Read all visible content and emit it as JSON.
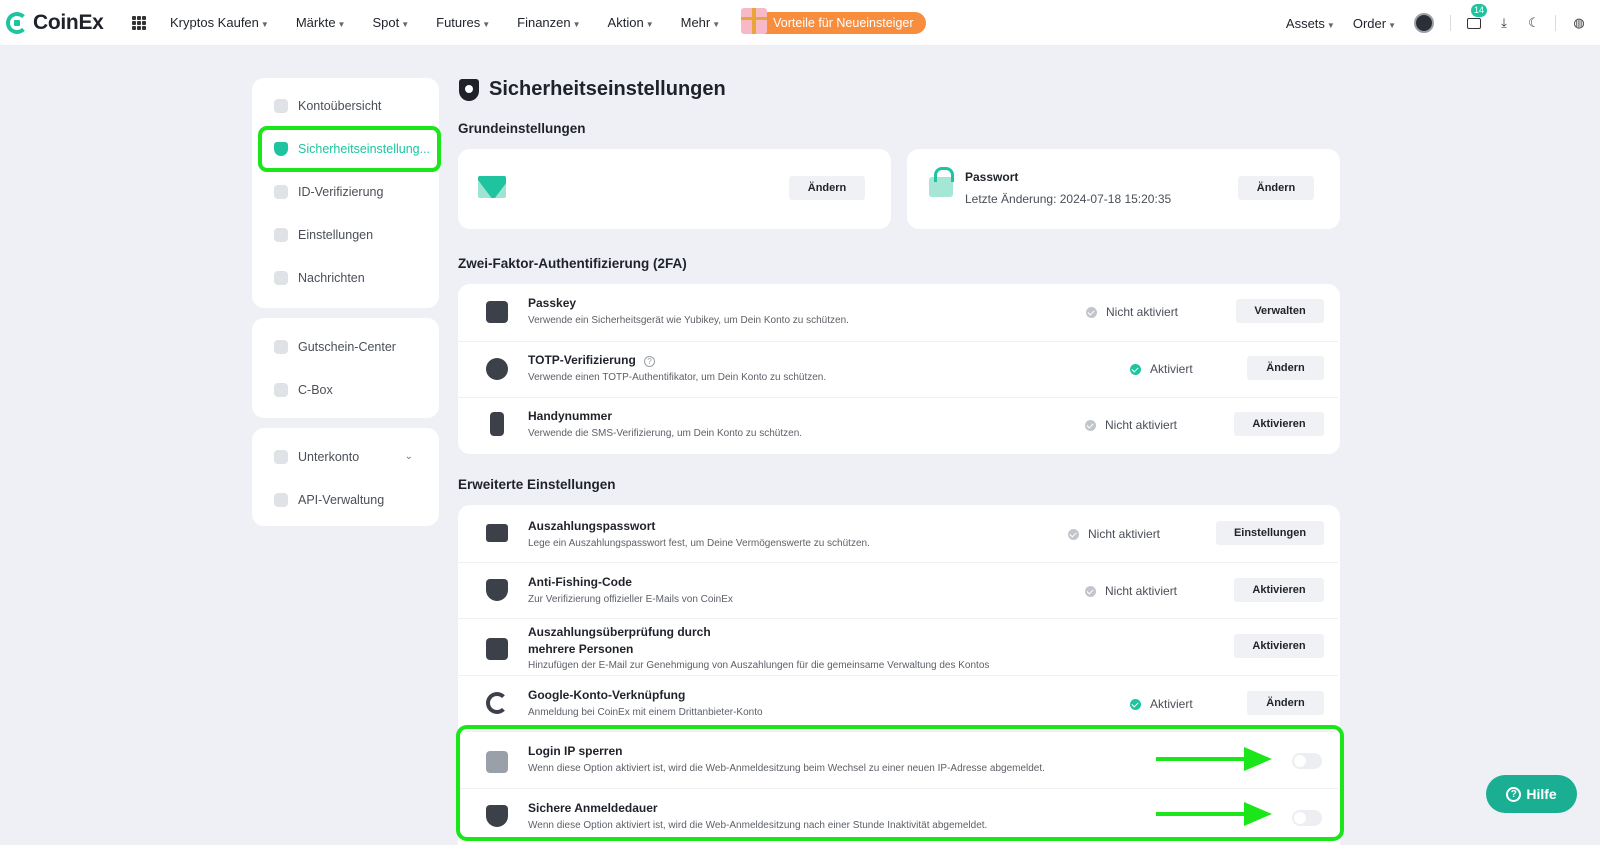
{
  "topnav": {
    "logo": "CoinEx",
    "items": [
      "Kryptos Kaufen",
      "Märkte",
      "Spot",
      "Futures",
      "Finanzen",
      "Aktion",
      "Mehr"
    ],
    "promo": "Vorteile für Neueinsteiger",
    "assets": "Assets",
    "order": "Order",
    "message_count": "14"
  },
  "sidebar": {
    "group1": [
      "Kontoübersicht",
      "Sicherheitseinstellung...",
      "ID-Verifizierung",
      "Einstellungen",
      "Nachrichten"
    ],
    "group2": [
      "Gutschein-Center",
      "C-Box"
    ],
    "group3": [
      "Unterkonto",
      "API-Verwaltung"
    ]
  },
  "main": {
    "title": "Sicherheitseinstellungen",
    "basic": {
      "title": "Grundeinstellungen",
      "email_button": "Ändern",
      "password_label": "Passwort",
      "password_date": "Letzte Änderung: 2024-07-18 15:20:35",
      "password_button": "Ändern"
    },
    "twofa": {
      "title": "Zwei-Faktor-Authentifizierung (2FA)",
      "rows": [
        {
          "title": "Passkey",
          "desc": "Verwende ein Sicherheitsgerät wie Yubikey, um Dein Konto zu schützen.",
          "status": "Nicht aktiviert",
          "button": "Verwalten"
        },
        {
          "title": "TOTP-Verifizierung",
          "desc": "Verwende einen TOTP-Authentifikator, um Dein Konto zu schützen.",
          "status": "Aktiviert",
          "button": "Ändern"
        },
        {
          "title": "Handynummer",
          "desc": "Verwende die SMS-Verifizierung, um Dein Konto zu schützen.",
          "status": "Nicht aktiviert",
          "button": "Aktivieren"
        }
      ]
    },
    "advanced": {
      "title": "Erweiterte Einstellungen",
      "rows": [
        {
          "title": "Auszahlungspasswort",
          "desc": "Lege ein Auszahlungspasswort fest, um Deine Vermögenswerte zu schützen.",
          "status": "Nicht aktiviert",
          "button": "Einstellungen"
        },
        {
          "title": "Anti-Fishing-Code",
          "desc": "Zur Verifizierung offizieller E-Mails von CoinEx",
          "status": "Nicht aktiviert",
          "button": "Aktivieren"
        },
        {
          "title_line1": "Auszahlungsüberprüfung durch",
          "title_line2": "mehrere Personen",
          "desc": "Hinzufügen der E-Mail zur Genehmigung von Auszahlungen für die gemeinsame Verwaltung des Kontos",
          "button": "Aktivieren"
        },
        {
          "title": "Google-Konto-Verknüpfung",
          "desc": "Anmeldung bei CoinEx mit einem Drittanbieter-Konto",
          "status": "Aktiviert",
          "button": "Ändern"
        },
        {
          "title": "Login IP sperren",
          "desc": "Wenn diese Option aktiviert ist, wird die Web-Anmeldesitzung beim Wechsel zu einer neuen IP-Adresse abgemeldet.",
          "toggle_on": false
        },
        {
          "title": "Sichere Anmeldedauer",
          "desc": "Wenn diese Option aktiviert ist, wird die Web-Anmeldesitzung nach einer Stunde Inaktivität abgemeldet.",
          "toggle_on": false
        }
      ]
    }
  },
  "help": {
    "label": "Hilfe"
  },
  "colors": {
    "accent": "#1ec4a0",
    "highlight": "#1ae61a"
  }
}
